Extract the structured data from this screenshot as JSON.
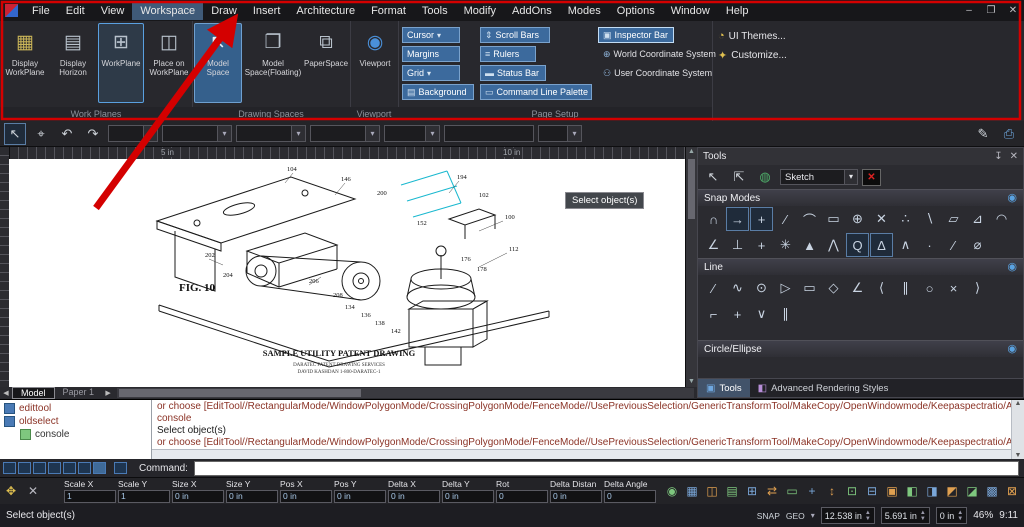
{
  "colors": {
    "accent_blue": "#3c6a9d",
    "annotation_red": "#d40000",
    "console_text": "#8b3326",
    "canvas_bg": "#ffffff"
  },
  "window": {
    "minimize": "–",
    "maximize": "❐",
    "close": "✕"
  },
  "menu": {
    "items": [
      "File",
      "Edit",
      "View",
      "Workspace",
      "Draw",
      "Insert",
      "Architecture",
      "Format",
      "Tools",
      "Modify",
      "AddOns",
      "Modes",
      "Options",
      "Window",
      "Help"
    ]
  },
  "ribbon": {
    "work_planes": {
      "label": "Work Planes",
      "buttons": [
        {
          "label": "Display WorkPlane",
          "icon": "▦"
        },
        {
          "label": "Display Horizon",
          "icon": "▤"
        },
        {
          "label": "WorkPlane",
          "icon": "⊞"
        },
        {
          "label": "Place on WorkPlane",
          "icon": "◫"
        }
      ]
    },
    "drawing_spaces": {
      "label": "Drawing Spaces",
      "buttons": [
        {
          "label": "Model Space",
          "icon": "↖"
        },
        {
          "label": "Model Space(Floating)",
          "icon": "❐"
        },
        {
          "label": "PaperSpace",
          "icon": "⧉"
        }
      ]
    },
    "viewport": {
      "label": "Viewport",
      "buttons": [
        {
          "label": "Viewport",
          "icon": "◉"
        }
      ]
    },
    "page_setup": {
      "label": "Page Setup",
      "col1": [
        {
          "label": "Cursor",
          "caret": "▾"
        },
        {
          "label": "Margins"
        },
        {
          "label": "Grid",
          "caret": "▾"
        },
        {
          "label": "Background",
          "icon": "▤"
        }
      ],
      "col2": [
        {
          "label": "Scroll Bars",
          "icon": "⇕"
        },
        {
          "label": "Rulers",
          "icon": "≡"
        },
        {
          "label": "Status Bar",
          "icon": "▬"
        },
        {
          "label": "Command Line Palette",
          "icon": "▭"
        }
      ],
      "col3": [
        {
          "label": "Inspector Bar",
          "icon": "▣"
        },
        {
          "label": "World Coordinate System",
          "icon": "⊕"
        },
        {
          "label": "User Coordinate System",
          "icon": "⚇"
        }
      ]
    },
    "right_buttons": [
      {
        "label": "UI Themes...",
        "icon": "◔"
      },
      {
        "label": "Customize...",
        "icon": "✦"
      }
    ]
  },
  "toolbar2": {
    "icons": [
      "↖",
      "⌖",
      "↶",
      "↷"
    ],
    "right_icons": [
      "✎",
      "⎙"
    ]
  },
  "ruler": {
    "labels": [
      "5 in",
      "10 in"
    ]
  },
  "canvas": {
    "tooltip": "Select object(s)",
    "figure_label": "FIG. 10",
    "caption": "SAMPLE UTILITY PATENT DRAWING",
    "subcaption1": "DARATEC PATENT DRAWING SERVICES",
    "subcaption2": "DAVID KASHDAN 1-800-DARATEC-1",
    "callouts": [
      "104",
      "146",
      "200",
      "194",
      "102",
      "100",
      "112",
      "152",
      "176",
      "178",
      "202",
      "204",
      "206",
      "208",
      "134",
      "136",
      "138",
      "142"
    ]
  },
  "tools_panel": {
    "title": "Tools",
    "pin_icon": "↧",
    "close_icon": "✕",
    "toolbar": {
      "icons": [
        "↖",
        "⇱",
        "◍"
      ],
      "combo_value": "Sketch",
      "caret": "▾",
      "style_icon": "✕"
    },
    "sections": {
      "snap": "Snap Modes",
      "line": "Line",
      "circle": "Circle/Ellipse"
    },
    "section_button": "◉",
    "snap_row1": [
      "∩",
      "→",
      "+",
      "∕",
      "⌒",
      "▭",
      "⊕",
      "✕",
      "∴",
      "∖",
      "▱",
      "⊿",
      "◠"
    ],
    "snap_row2": [
      "∠",
      "⊥",
      "+",
      "✳",
      "▲",
      "⋀",
      "Q",
      "∆",
      "∧",
      "·",
      "∕",
      "⌀"
    ],
    "line_row1": [
      "∕",
      "∿",
      "⊙",
      "▷",
      "▭",
      "◇",
      "∠",
      "⟨",
      "∥",
      "○",
      "×",
      "⟩"
    ],
    "line_row2": [
      "⌐",
      "+",
      "∨",
      "∥"
    ],
    "tabs": [
      {
        "label": "Tools",
        "icon": "▣"
      },
      {
        "label": "Advanced Rendering Styles",
        "icon": "◧"
      }
    ]
  },
  "sheet_tabs": {
    "model": "Model",
    "paper": "Paper 1"
  },
  "console": {
    "tree": [
      {
        "label": "edittool"
      },
      {
        "label": "oldselect"
      },
      {
        "label": "console"
      }
    ],
    "lines": [
      "or choose [EditTool//RectangularMode/WindowPolygonMode/CrossingPolygonMode/FenceMode//UsePreviousSelection/GenericTransformTool/MakeCopy/OpenWindowmode/Keepaspectratio/Autoselectcom",
      "console",
      "Select object(s)",
      "or choose [EditTool//RectangularMode/WindowPolygonMode/CrossingPolygonMode/FenceMode//UsePreviousSelection/GenericTransformTool/MakeCopy/OpenWindowmode/Keepaspectratio/Autoselectcom"
    ]
  },
  "command": {
    "label": "Command:"
  },
  "inspector": {
    "left_icons": [
      "✥",
      "✕"
    ],
    "fields": [
      {
        "label": "Scale X",
        "value": "1"
      },
      {
        "label": "Scale Y",
        "value": "1"
      },
      {
        "label": "Size X",
        "value": "0 in"
      },
      {
        "label": "Size Y",
        "value": "0 in"
      },
      {
        "label": "Pos X",
        "value": "0 in"
      },
      {
        "label": "Pos Y",
        "value": "0 in"
      },
      {
        "label": "Delta X",
        "value": "0 in"
      },
      {
        "label": "Delta Y",
        "value": "0 in"
      },
      {
        "label": "Rot",
        "value": "0"
      },
      {
        "label": "Delta Distan",
        "value": "0 in"
      },
      {
        "label": "Delta Angle",
        "value": "0"
      }
    ],
    "icons": [
      "◉",
      "▦",
      "◫",
      "▤",
      "⊞",
      "⇄",
      "▭",
      "+",
      "↕",
      "⊡",
      "⊟",
      "▣",
      "◧",
      "◨",
      "◩",
      "◪",
      "▩",
      "⊠"
    ]
  },
  "status": {
    "message": "Select object(s)",
    "snap_label": "SNAP",
    "geo_label": "GEO",
    "coord_x": "12.538 in",
    "coord_y": "5.691 in",
    "coord_z": "0 in",
    "zoom": "46%",
    "time": "9:11"
  }
}
